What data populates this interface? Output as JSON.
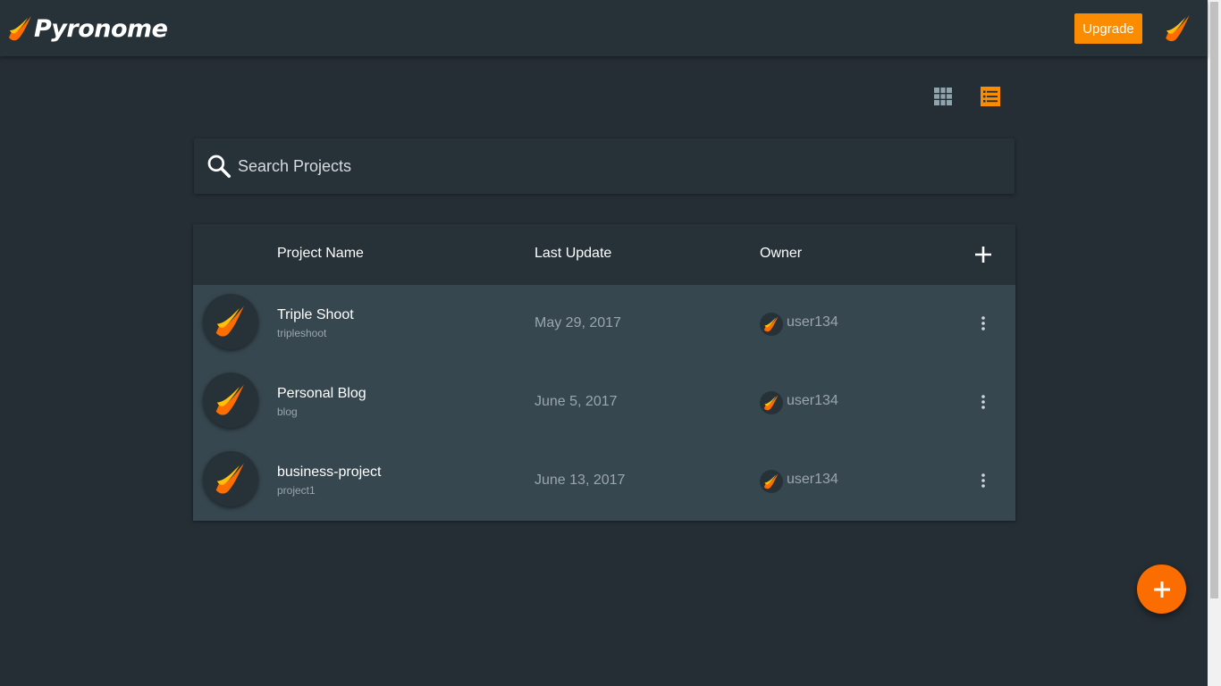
{
  "header": {
    "brand_name": "Pyronome",
    "upgrade_label": "Upgrade"
  },
  "search": {
    "placeholder": "Search Projects",
    "value": ""
  },
  "view_toggles": {
    "grid_icon": "grid-view-icon",
    "list_icon": "list-view-icon",
    "active": "list"
  },
  "table": {
    "columns": {
      "name": "Project Name",
      "last_update": "Last Update",
      "owner": "Owner"
    },
    "rows": [
      {
        "name": "Triple Shoot",
        "slug": "tripleshoot",
        "last_update": "May 29, 2017",
        "owner": "user134"
      },
      {
        "name": "Personal Blog",
        "slug": "blog",
        "last_update": "June 5, 2017",
        "owner": "user134"
      },
      {
        "name": "business-project",
        "slug": "project1",
        "last_update": "June 13, 2017",
        "owner": "user134"
      }
    ]
  },
  "colors": {
    "accent": "#fb8c00",
    "background": "#252e35",
    "surface": "#263138",
    "row_bg": "#37474f"
  }
}
